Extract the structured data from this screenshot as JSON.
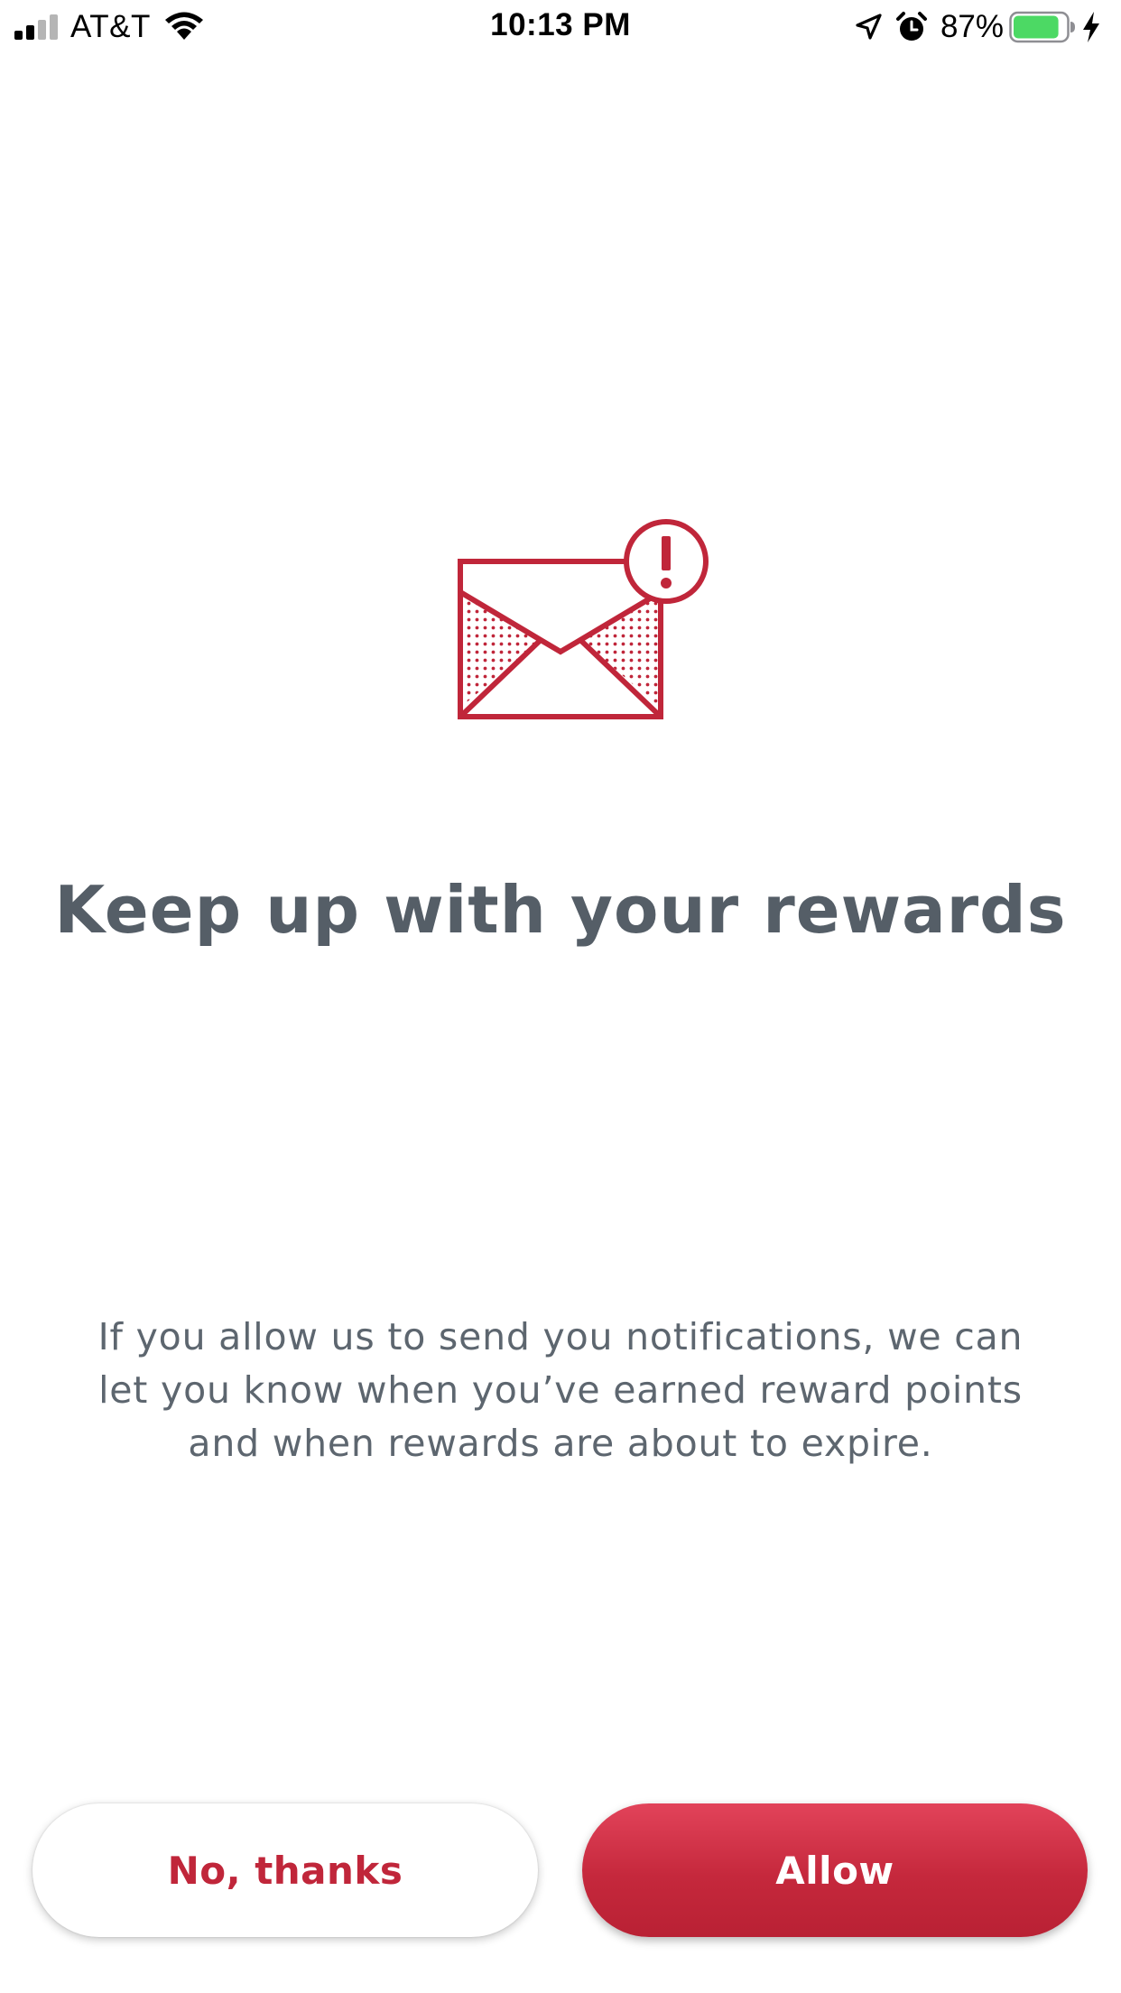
{
  "status_bar": {
    "carrier": "AT&T",
    "time": "10:13 PM",
    "battery_percent": "87%",
    "icons": [
      "signal-icon",
      "wifi-icon",
      "location-icon",
      "alarm-icon",
      "battery-icon",
      "charging-icon"
    ],
    "battery_level": 0.87,
    "battery_color": "#4cd964"
  },
  "hero": {
    "icon": "envelope-alert-icon",
    "accent_color": "#c0263a"
  },
  "content": {
    "title": "Keep up with your rewards",
    "body_lines": [
      "If you allow us to send you notifications, we can",
      "let you know when you’ve earned reward points",
      "and when rewards are about to expire."
    ]
  },
  "actions": {
    "decline_label": "No, thanks",
    "allow_label": "Allow"
  },
  "colors": {
    "accent": "#c0263a",
    "title": "#555e67",
    "body": "#5d666f"
  }
}
